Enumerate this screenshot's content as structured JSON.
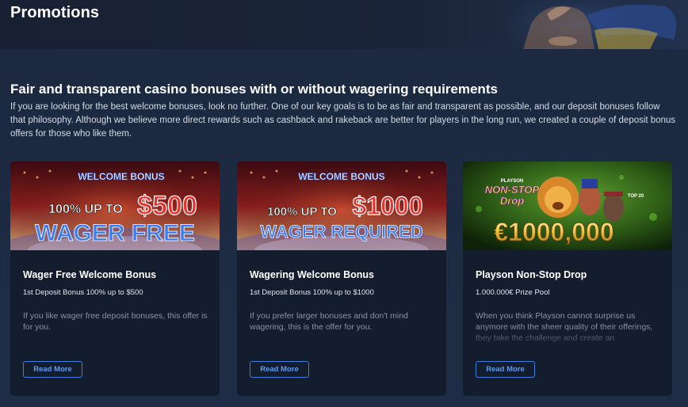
{
  "header": {
    "title": "Promotions"
  },
  "intro": {
    "heading": "Fair and transparent casino bonuses with or without wagering requirements",
    "description": "If you are looking for the best welcome bonuses, look no further. One of our key goals is to be as fair and transparent as possible, and our deposit bonuses follow that philosophy. Although we believe more direct rewards such as cashback and rakeback are better for players in the long run, we created a couple of deposit bonus offers for those who like them."
  },
  "cards": [
    {
      "image": {
        "badge": "WELCOME BONUS",
        "line1_small": "100% UP TO",
        "line1_big": "$500",
        "line2": "WAGER FREE"
      },
      "title": "Wager Free Welcome Bonus",
      "subtitle": "1st Deposit Bonus 100% up to $500",
      "text": "If you like wager free deposit bonuses, this offer is for you.",
      "button": "Read More"
    },
    {
      "image": {
        "badge": "WELCOME BONUS",
        "line1_small": "100% UP TO",
        "line1_big": "$1000",
        "line2": "WAGER REQUIRED"
      },
      "title": "Wagering Welcome Bonus",
      "subtitle": "1st Deposit Bonus 100% up to $1000",
      "text": "If you prefer larger bonuses and don't mind wagering, this is the offer for you.",
      "button": "Read More"
    },
    {
      "image": {
        "brand": "PLAYSON",
        "logo_line1": "NON-STOP",
        "logo_line2": "Drop",
        "tag": "TOP 20",
        "amount": "€1000,000"
      },
      "title": "Playson Non-Stop Drop",
      "subtitle": "1.000.000€ Prize Pool",
      "text": "When you think Playson cannot surprise us anymore with the sheer quality of their offerings, they take the challenge and create an",
      "button": "Read More"
    }
  ],
  "colors": {
    "background": "#1a2538",
    "card": "#141d2d",
    "accent": "#3d7fe0",
    "bonus_red": "#e8302a",
    "bonus_blue": "#3b7cf0"
  }
}
